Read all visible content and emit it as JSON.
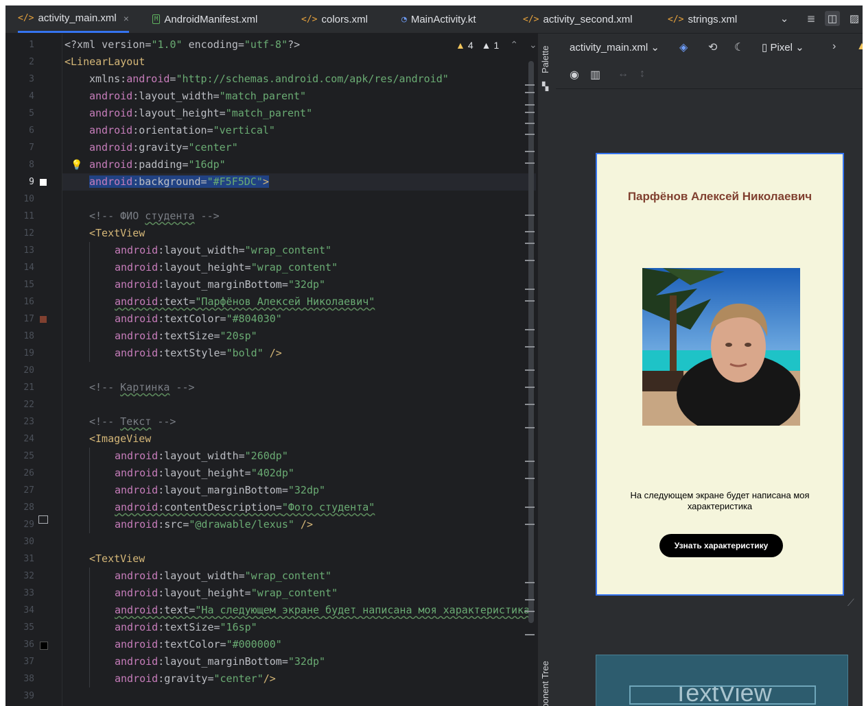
{
  "tabs": [
    {
      "label": "activity_main.xml",
      "icon": "xml-icon",
      "active": true
    },
    {
      "label": "AndroidManifest.xml",
      "icon": "manifest-icon"
    },
    {
      "label": "colors.xml",
      "icon": "xml-icon"
    },
    {
      "label": "MainActivity.kt",
      "icon": "kotlin-icon"
    },
    {
      "label": "activity_second.xml",
      "icon": "xml-icon"
    },
    {
      "label": "strings.xml",
      "icon": "xml-icon"
    }
  ],
  "tab_close": "×",
  "inspection": {
    "warnings": "4",
    "weak_warnings": "1"
  },
  "palette_label": "Palette",
  "component_tree_label": "Component Tree",
  "design_toolbar": {
    "file": "activity_main.xml",
    "device": "Pixel"
  },
  "preview": {
    "name": "Парфёнов Алексей Николаевич",
    "description": "На следующем экране будет написана моя характеристика",
    "button": "Узнать характеристику",
    "textview_label": "TextView"
  },
  "colors": {
    "background": "#F5F5DC",
    "name_text": "#804030",
    "button": "#000000",
    "accent": "#3574f0"
  },
  "code": {
    "l1": [
      "<?xml version=",
      "\"1.0\"",
      " encoding=",
      "\"utf-8\"",
      "?>"
    ],
    "l2": "<LinearLayout",
    "l3": [
      "xmlns:",
      "android",
      "=",
      "\"http://schemas.android.com/apk/res/android\""
    ],
    "l4": [
      "android",
      ":layout_width=",
      "\"match_parent\""
    ],
    "l5": [
      "android",
      ":layout_height=",
      "\"match_parent\""
    ],
    "l6": [
      "android",
      ":orientation=",
      "\"vertical\""
    ],
    "l7": [
      "android",
      ":gravity=",
      "\"center\""
    ],
    "l8": [
      "android",
      ":padding=",
      "\"16dp\""
    ],
    "l9": [
      "android",
      ":background=",
      "\"#F5F5DC\"",
      ">"
    ],
    "l11": [
      "<!-- ",
      "ФИО",
      " ",
      "студента",
      " -->"
    ],
    "l12": "<TextView",
    "l13": [
      "android",
      ":layout_width=",
      "\"wrap_content\""
    ],
    "l14": [
      "android",
      ":layout_height=",
      "\"wrap_content\""
    ],
    "l15": [
      "android",
      ":layout_marginBottom=",
      "\"32dp\""
    ],
    "l16": [
      "android",
      ":text=",
      "\"Парфёнов Алексей Николаевич\""
    ],
    "l17": [
      "android",
      ":textColor=",
      "\"#804030\""
    ],
    "l18": [
      "android",
      ":textSize=",
      "\"20sp\""
    ],
    "l19": [
      "android",
      ":textStyle=",
      "\"bold\"",
      " />"
    ],
    "l21": [
      "<!-- ",
      "Картинка",
      " -->"
    ],
    "l23": [
      "<!-- ",
      "Текст",
      " -->"
    ],
    "l24": "<ImageView",
    "l25": [
      "android",
      ":layout_width=",
      "\"260dp\""
    ],
    "l26": [
      "android",
      ":layout_height=",
      "\"402dp\""
    ],
    "l27": [
      "android",
      ":layout_marginBottom=",
      "\"32dp\""
    ],
    "l28": [
      "android",
      ":contentDescription=",
      "\"Фото студента\""
    ],
    "l29": [
      "android",
      ":src=",
      "\"@drawable/lexus\"",
      " />"
    ],
    "l31": "<TextView",
    "l32": [
      "android",
      ":layout_width=",
      "\"wrap_content\""
    ],
    "l33": [
      "android",
      ":layout_height=",
      "\"wrap_content\""
    ],
    "l34": [
      "android",
      ":text=",
      "\"На следующем экране будет написана моя характеристика"
    ],
    "l35": [
      "android",
      ":textSize=",
      "\"16sp\""
    ],
    "l36": [
      "android",
      ":textColor=",
      "\"#000000\""
    ],
    "l37": [
      "android",
      ":layout_marginBottom=",
      "\"32dp\""
    ],
    "l38": [
      "android",
      ":gravity=",
      "\"center\"",
      "/>"
    ]
  }
}
